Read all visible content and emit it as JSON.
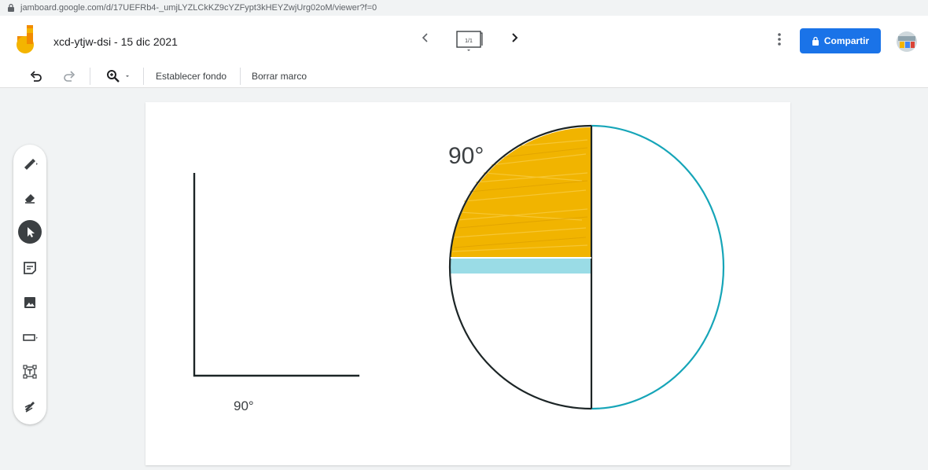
{
  "browser": {
    "url": "jamboard.google.com/d/17UEFRb4-_umjLYZLCkKZ9cYZFypt3kHEYZwjUrg02oM/viewer?f=0"
  },
  "header": {
    "title": "xcd-ytjw-dsi",
    "separator": " - ",
    "date": "15 dic 2021",
    "frame_indicator": "1/1",
    "share_label": "Compartir"
  },
  "toolbar": {
    "set_background_label": "Establecer fondo",
    "clear_frame_label": "Borrar marco"
  },
  "palette": {
    "tools": [
      "pen",
      "eraser",
      "select",
      "sticky-note",
      "image",
      "shape",
      "text-box",
      "laser"
    ],
    "active": "select"
  },
  "canvas": {
    "label_circle": "90°",
    "label_angle": "90°"
  },
  "colors": {
    "accent_blue": "#1a73e8",
    "fill_yellow": "#f1b400",
    "circle_teal": "#16a5b8",
    "band_cyan": "#9adce6",
    "stroke_dark": "#1c2526"
  }
}
